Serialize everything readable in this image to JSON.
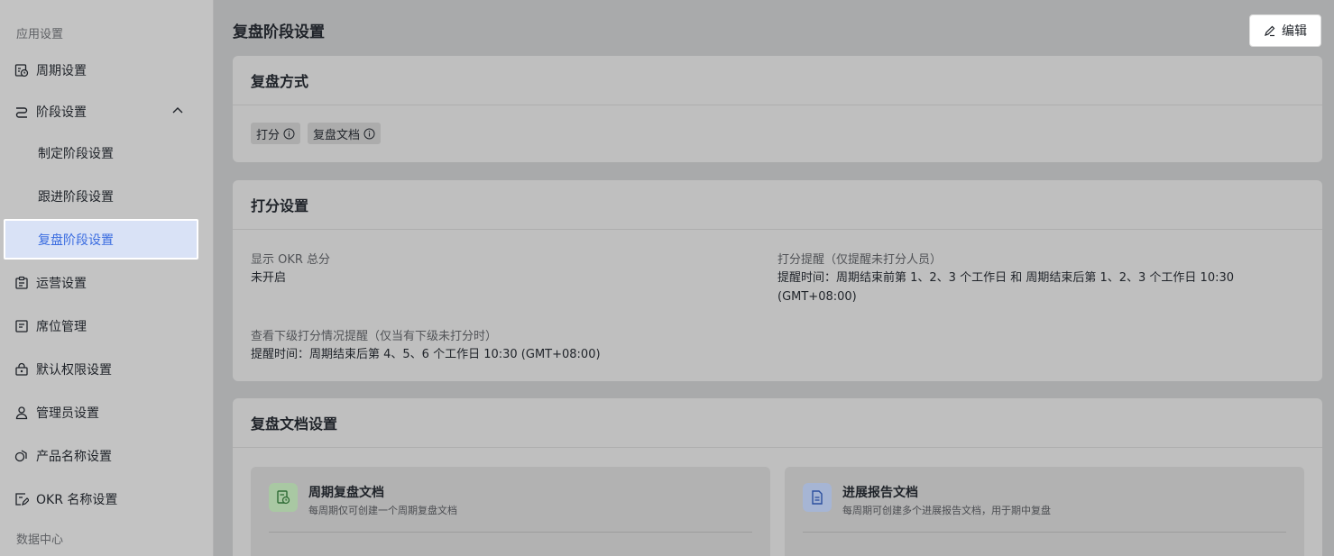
{
  "sidebar": {
    "app_settings_title": "应用设置",
    "data_center_title": "数据中心",
    "items": {
      "cycle": "周期设置",
      "stage": "阶段设置",
      "stage_sub": [
        "制定阶段设置",
        "跟进阶段设置"
      ],
      "stage_active": "复盘阶段设置",
      "ops": "运营设置",
      "seat": "席位管理",
      "perm": "默认权限设置",
      "admin": "管理员设置",
      "product": "产品名称设置",
      "okrname": "OKR 名称设置"
    }
  },
  "main": {
    "title": "复盘阶段设置",
    "edit_label": "编辑",
    "review_method": {
      "title": "复盘方式",
      "tags": [
        "打分",
        "复盘文档"
      ]
    },
    "scoring": {
      "title": "打分设置",
      "show_total_label": "显示 OKR 总分",
      "show_total_value": "未开启",
      "remind_label": "打分提醒（仅提醒未打分人员）",
      "remind_value_1": "提醒时间：周期结束前第 1、2、3 个工作日 和 周期结束后第 1、2、3 个工作日 10:30",
      "remind_value_2": "(GMT+08:00)",
      "sub_label": "查看下级打分情况提醒（仅当有下级未打分时）",
      "sub_value": "提醒时间：周期结束后第 4、5、6 个工作日 10:30 (GMT+08:00)"
    },
    "doc_settings": {
      "title": "复盘文档设置",
      "cycle_doc_title": "周期复盘文档",
      "cycle_doc_desc": "每周期仅可创建一个周期复盘文档",
      "progress_doc_title": "进展报告文档",
      "progress_doc_desc": "每周期可创建多个进展报告文档，用于期中复盘"
    }
  }
}
